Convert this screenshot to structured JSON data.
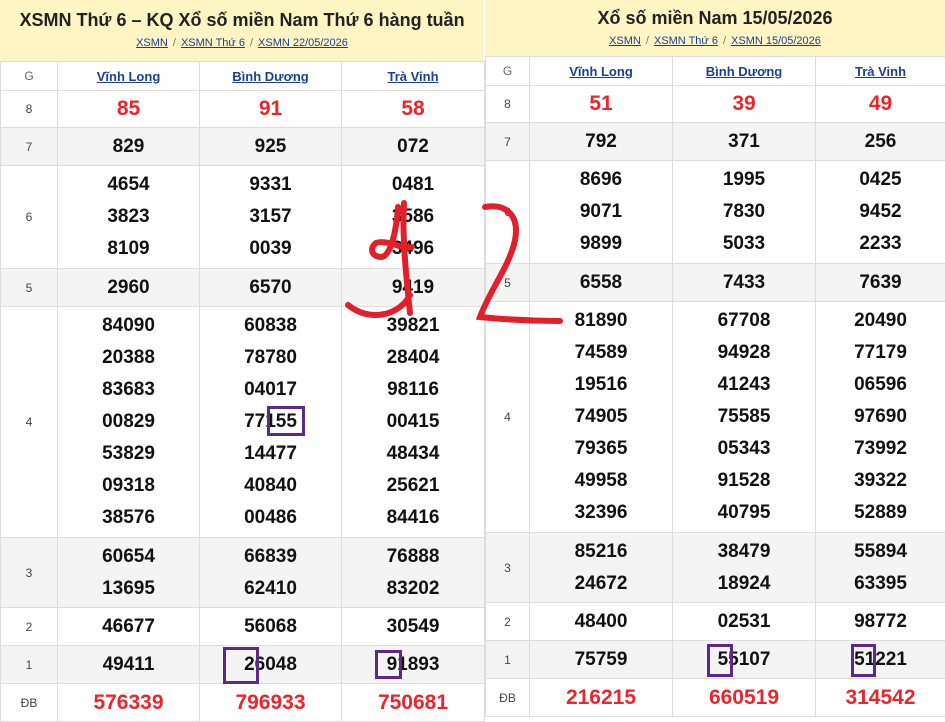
{
  "left": {
    "title": "XSMN Thứ 6 – KQ Xổ số miền Nam Thứ 6 hàng tuần",
    "breadcrumbs": [
      "XSMN",
      "XSMN Thứ 6",
      "XSMN 22/05/2026"
    ],
    "columns": [
      "G",
      "Vĩnh Long",
      "Bình Dương",
      "Trà Vinh"
    ],
    "rows": [
      {
        "g": "8",
        "vals": [
          [
            "85"
          ],
          [
            "91"
          ],
          [
            "58"
          ]
        ]
      },
      {
        "g": "7",
        "vals": [
          [
            "829"
          ],
          [
            "925"
          ],
          [
            "072"
          ]
        ]
      },
      {
        "g": "6",
        "vals": [
          [
            "4654",
            "3823",
            "8109"
          ],
          [
            "9331",
            "3157",
            "0039"
          ],
          [
            "0481",
            "3586",
            "3496"
          ]
        ]
      },
      {
        "g": "5",
        "vals": [
          [
            "2960"
          ],
          [
            "6570"
          ],
          [
            "9419"
          ]
        ]
      },
      {
        "g": "4",
        "vals": [
          [
            "84090",
            "20388",
            "83683",
            "00829",
            "53829",
            "09318",
            "38576"
          ],
          [
            "60838",
            "78780",
            "04017",
            "77155",
            "14477",
            "40840",
            "00486"
          ],
          [
            "39821",
            "28404",
            "98116",
            "00415",
            "48434",
            "25621",
            "84416"
          ]
        ]
      },
      {
        "g": "3",
        "vals": [
          [
            "60654",
            "13695"
          ],
          [
            "66839",
            "62410"
          ],
          [
            "76888",
            "83202"
          ]
        ]
      },
      {
        "g": "2",
        "vals": [
          [
            "46677"
          ],
          [
            "56068"
          ],
          [
            "30549"
          ]
        ]
      },
      {
        "g": "1",
        "vals": [
          [
            "49411"
          ],
          [
            "26048"
          ],
          [
            "91893"
          ]
        ]
      },
      {
        "g": "ĐB",
        "vals": [
          [
            "576339"
          ],
          [
            "796933"
          ],
          [
            "750681"
          ]
        ]
      }
    ]
  },
  "right": {
    "title": "Xổ số miền Nam 15/05/2026",
    "breadcrumbs": [
      "XSMN",
      "XSMN Thứ 6",
      "XSMN 15/05/2026"
    ],
    "columns": [
      "G",
      "Vĩnh Long",
      "Bình Dương",
      "Trà Vinh"
    ],
    "rows": [
      {
        "g": "8",
        "vals": [
          [
            "51"
          ],
          [
            "39"
          ],
          [
            "49"
          ]
        ]
      },
      {
        "g": "7",
        "vals": [
          [
            "792"
          ],
          [
            "371"
          ],
          [
            "256"
          ]
        ]
      },
      {
        "g": "6",
        "vals": [
          [
            "8696",
            "9071",
            "9899"
          ],
          [
            "1995",
            "7830",
            "5033"
          ],
          [
            "0425",
            "9452",
            "2233"
          ]
        ]
      },
      {
        "g": "5",
        "vals": [
          [
            "6558"
          ],
          [
            "7433"
          ],
          [
            "7639"
          ]
        ]
      },
      {
        "g": "4",
        "vals": [
          [
            "81890",
            "74589",
            "19516",
            "74905",
            "79365",
            "49958",
            "32396"
          ],
          [
            "67708",
            "94928",
            "41243",
            "75585",
            "05343",
            "91528",
            "40795"
          ],
          [
            "20490",
            "77179",
            "06596",
            "97690",
            "73992",
            "39322",
            "52889"
          ]
        ]
      },
      {
        "g": "3",
        "vals": [
          [
            "85216",
            "24672"
          ],
          [
            "38479",
            "18924"
          ],
          [
            "55894",
            "63395"
          ]
        ]
      },
      {
        "g": "2",
        "vals": [
          [
            "48400"
          ],
          [
            "02531"
          ],
          [
            "98772"
          ]
        ]
      },
      {
        "g": "1",
        "vals": [
          [
            "75759"
          ],
          [
            "55107"
          ],
          [
            "51221"
          ]
        ]
      },
      {
        "g": "ĐB",
        "vals": [
          [
            "216215"
          ],
          [
            "660519"
          ],
          [
            "314542"
          ]
        ]
      }
    ]
  },
  "colors": {
    "header_bg": "#fdf6c4",
    "link": "#1c3f95",
    "red": "#e8262d",
    "highlight_box": "#5b2a86",
    "scribble": "#e0202a"
  }
}
